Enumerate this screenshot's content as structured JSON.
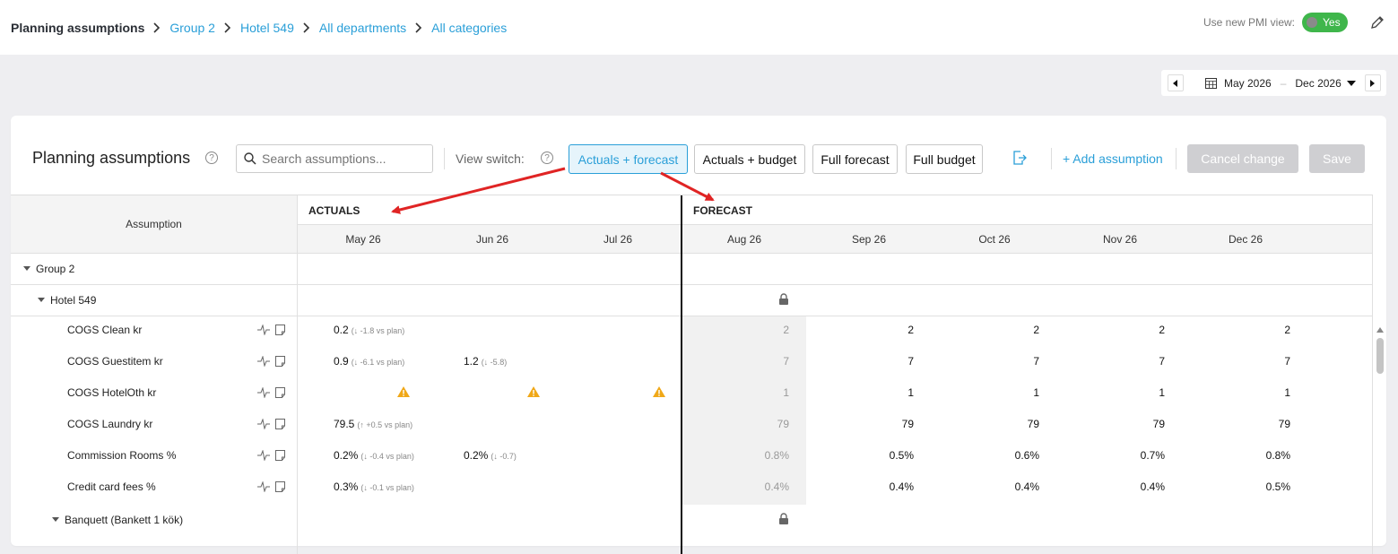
{
  "breadcrumb": {
    "root": "Planning assumptions",
    "items": [
      "Group 2",
      "Hotel 549",
      "All departments",
      "All categories"
    ]
  },
  "pmi": {
    "label": "Use new PMI view:",
    "toggle_value": "Yes"
  },
  "date_range": {
    "start": "May 2026",
    "separator": "–",
    "end": "Dec 2026"
  },
  "card": {
    "title": "Planning assumptions",
    "search_placeholder": "Search assumptions...",
    "view_switch_label": "View switch:",
    "view_buttons": [
      "Actuals + forecast",
      "Actuals + budget",
      "Full forecast",
      "Full budget"
    ],
    "active_view": "Actuals + forecast",
    "add_label": "+ Add assumption",
    "cancel_label": "Cancel change",
    "save_label": "Save"
  },
  "grid": {
    "assumption_header": "Assumption",
    "actuals_label": "ACTUALS",
    "forecast_label": "FORECAST",
    "months": [
      "May 26",
      "Jun 26",
      "Jul 26",
      "Aug 26",
      "Sep 26",
      "Oct 26",
      "Nov 26",
      "Dec 26"
    ],
    "groups": {
      "group": "Group 2",
      "hotel": "Hotel 549",
      "sub": "Banquett (Bankett 1 kök)"
    },
    "rows": [
      {
        "label": "COGS Clean kr",
        "actuals": [
          {
            "value": "0.2",
            "delta": "(↓ -1.8 vs plan)"
          },
          null,
          null
        ],
        "forecast": [
          "2",
          "2",
          "2",
          "2",
          "2"
        ]
      },
      {
        "label": "COGS Guestitem kr",
        "actuals": [
          {
            "value": "0.9",
            "delta": "(↓ -6.1 vs plan)"
          },
          {
            "value": "1.2",
            "delta": "(↓ -5.8)"
          },
          null
        ],
        "forecast": [
          "7",
          "7",
          "7",
          "7",
          "7"
        ]
      },
      {
        "label": "COGS HotelOth kr",
        "actuals": [
          "warning",
          "warning",
          "warning"
        ],
        "forecast": [
          "1",
          "1",
          "1",
          "1",
          "1"
        ]
      },
      {
        "label": "COGS Laundry kr",
        "actuals": [
          {
            "value": "79.5",
            "delta": "(↑ +0.5 vs plan)"
          },
          null,
          null
        ],
        "forecast": [
          "79",
          "79",
          "79",
          "79",
          "79"
        ]
      },
      {
        "label": "Commission Rooms %",
        "actuals": [
          {
            "value": "0.2%",
            "delta": "(↓ -0.4 vs plan)"
          },
          {
            "value": "0.2%",
            "delta": "(↓ -0.7)"
          },
          null
        ],
        "forecast": [
          "0.8%",
          "0.5%",
          "0.6%",
          "0.7%",
          "0.8%"
        ]
      },
      {
        "label": "Credit card fees %",
        "actuals": [
          {
            "value": "0.3%",
            "delta": "(↓ -0.1 vs plan)"
          },
          null,
          null
        ],
        "forecast": [
          "0.4%",
          "0.4%",
          "0.4%",
          "0.4%",
          "0.5%"
        ]
      }
    ]
  },
  "colors": {
    "accent": "#2a9fd8",
    "toggle_on": "#3fb64b",
    "annotation_arrow": "#e02424",
    "warning": "#f0a818"
  }
}
